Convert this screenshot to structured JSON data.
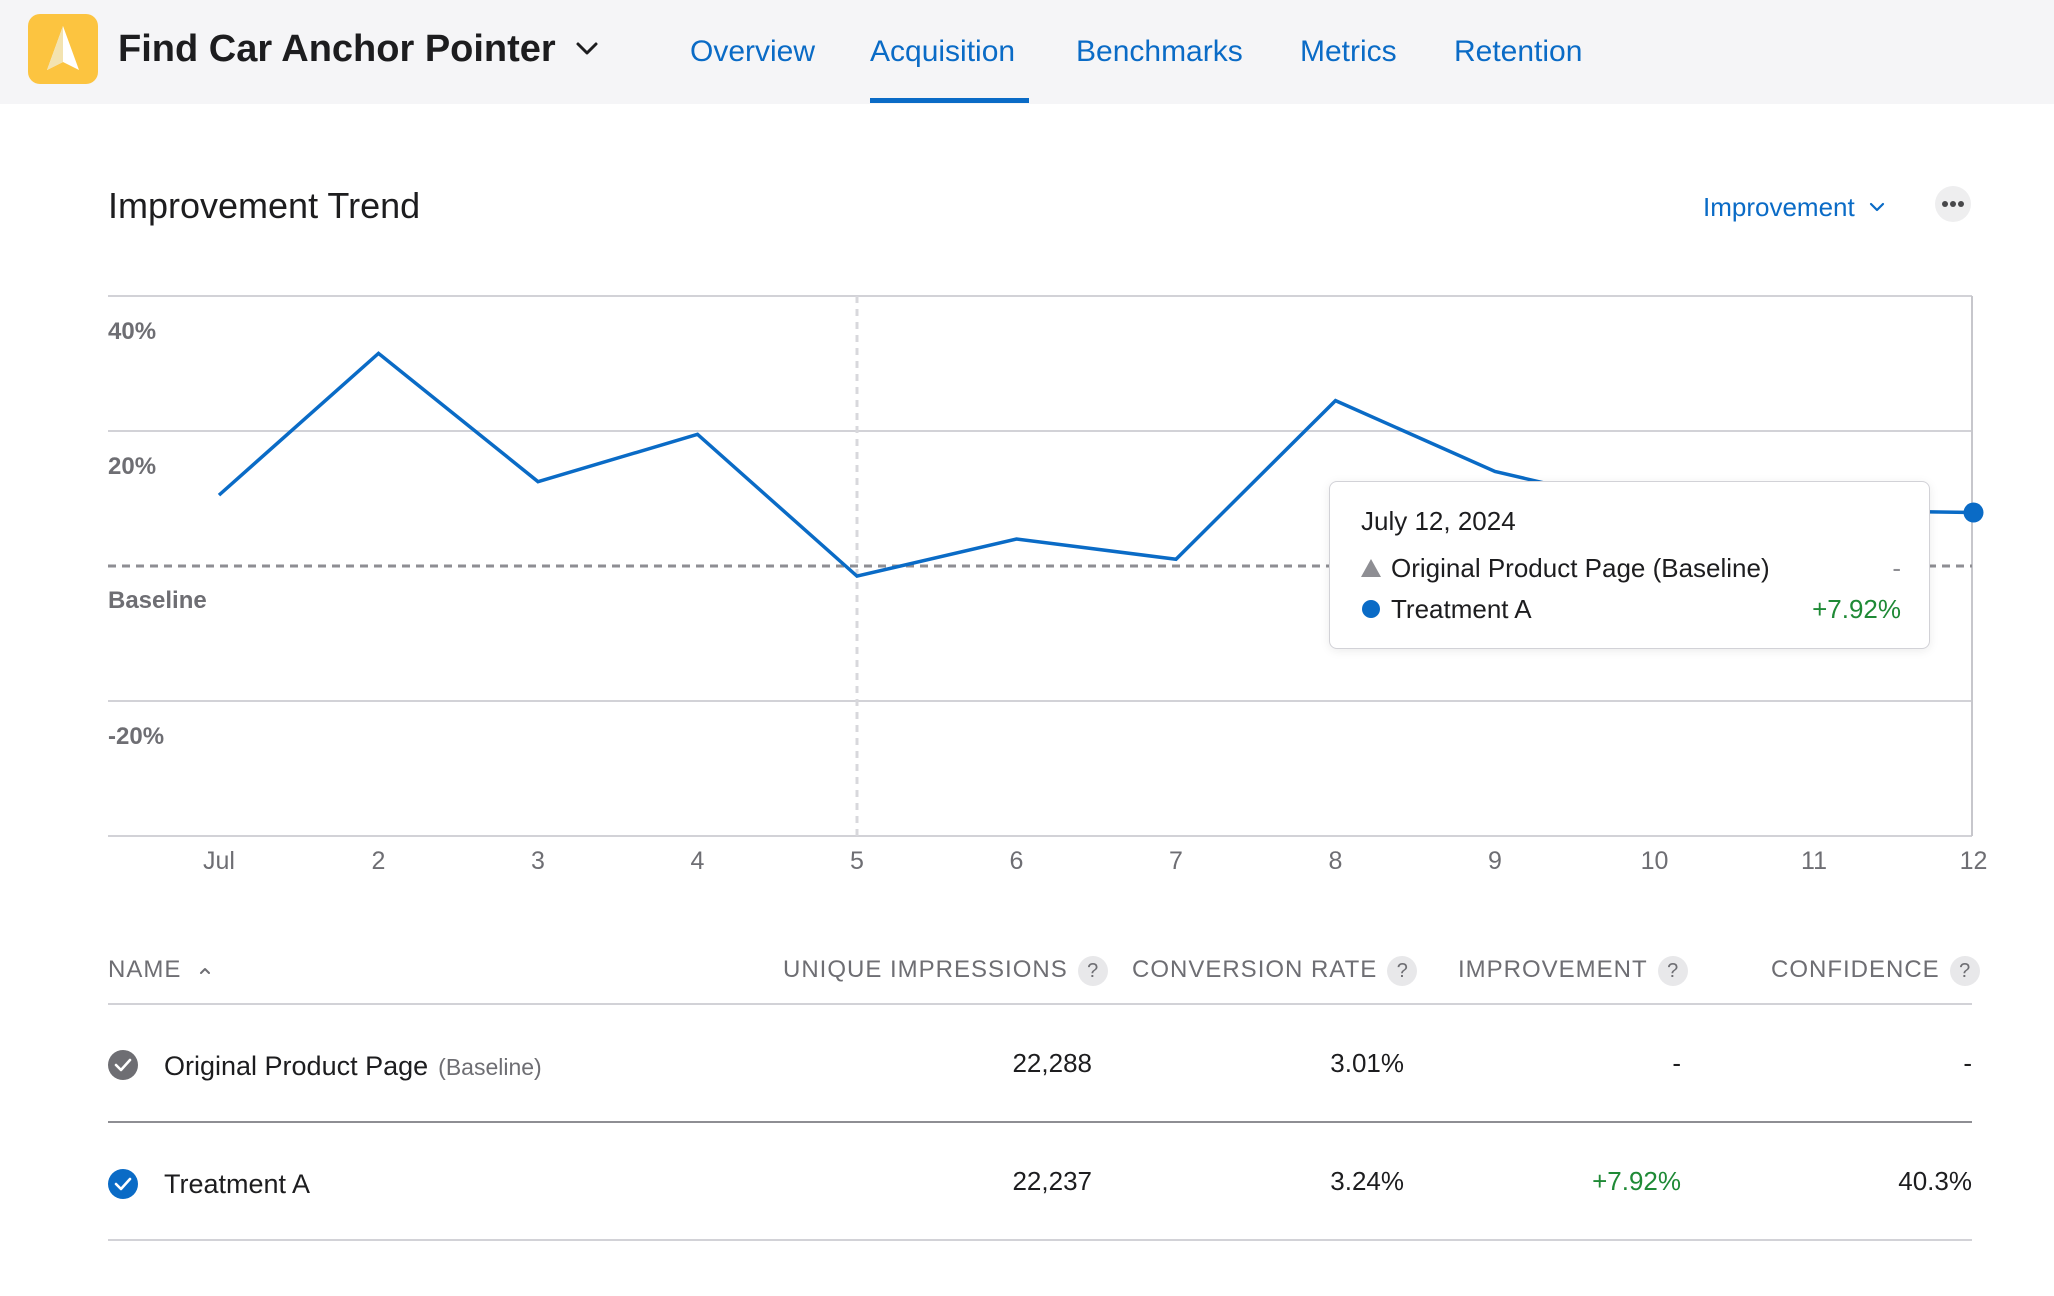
{
  "header": {
    "app_name": "Find Car Anchor Pointer",
    "tabs": [
      {
        "label": "Overview",
        "active": false
      },
      {
        "label": "Acquisition",
        "active": true
      },
      {
        "label": "Benchmarks",
        "active": false
      },
      {
        "label": "Metrics",
        "active": false
      },
      {
        "label": "Retention",
        "active": false
      }
    ],
    "accent_color": "#0a6bc6",
    "app_icon_color": "#fcc440"
  },
  "section": {
    "title": "Improvement Trend",
    "metric_selector": "Improvement",
    "more_icon": "ellipsis-icon"
  },
  "chart_data": {
    "type": "line",
    "x_labels": [
      "Jul",
      "2",
      "3",
      "4",
      "5",
      "6",
      "7",
      "8",
      "9",
      "10",
      "11",
      "12"
    ],
    "y_labels": [
      "40%",
      "20%",
      "Baseline",
      "-20%"
    ],
    "ylim": [
      -40,
      40
    ],
    "baseline_value": 0,
    "highlight_x": "5",
    "series": [
      {
        "name": "Treatment A",
        "color": "#0a6bc6",
        "values": [
          10.5,
          31.5,
          12.5,
          19.5,
          -1.5,
          4,
          1,
          24.5,
          14,
          8.5,
          8.3,
          7.92
        ]
      }
    ],
    "grid": true
  },
  "tooltip": {
    "date": "July 12, 2024",
    "rows": [
      {
        "name": "Original Product Page (Baseline)",
        "value": "-",
        "marker": "triangle"
      },
      {
        "name": "Treatment A",
        "value": "+7.92%",
        "marker": "circle"
      }
    ]
  },
  "table": {
    "headers": {
      "name": "NAME",
      "impressions": "UNIQUE IMPRESSIONS",
      "conversion": "CONVERSION RATE",
      "improvement": "IMPROVEMENT",
      "confidence": "CONFIDENCE",
      "help": "?"
    },
    "rows": [
      {
        "name": "Original Product Page",
        "sub": "(Baseline)",
        "impressions": "22,288",
        "conversion": "3.01%",
        "improvement": "-",
        "confidence": "-",
        "check_color": "#6e6e73"
      },
      {
        "name": "Treatment A",
        "sub": "",
        "impressions": "22,237",
        "conversion": "3.24%",
        "improvement": "+7.92%",
        "confidence": "40.3%",
        "check_color": "#0a6bc6"
      }
    ]
  }
}
